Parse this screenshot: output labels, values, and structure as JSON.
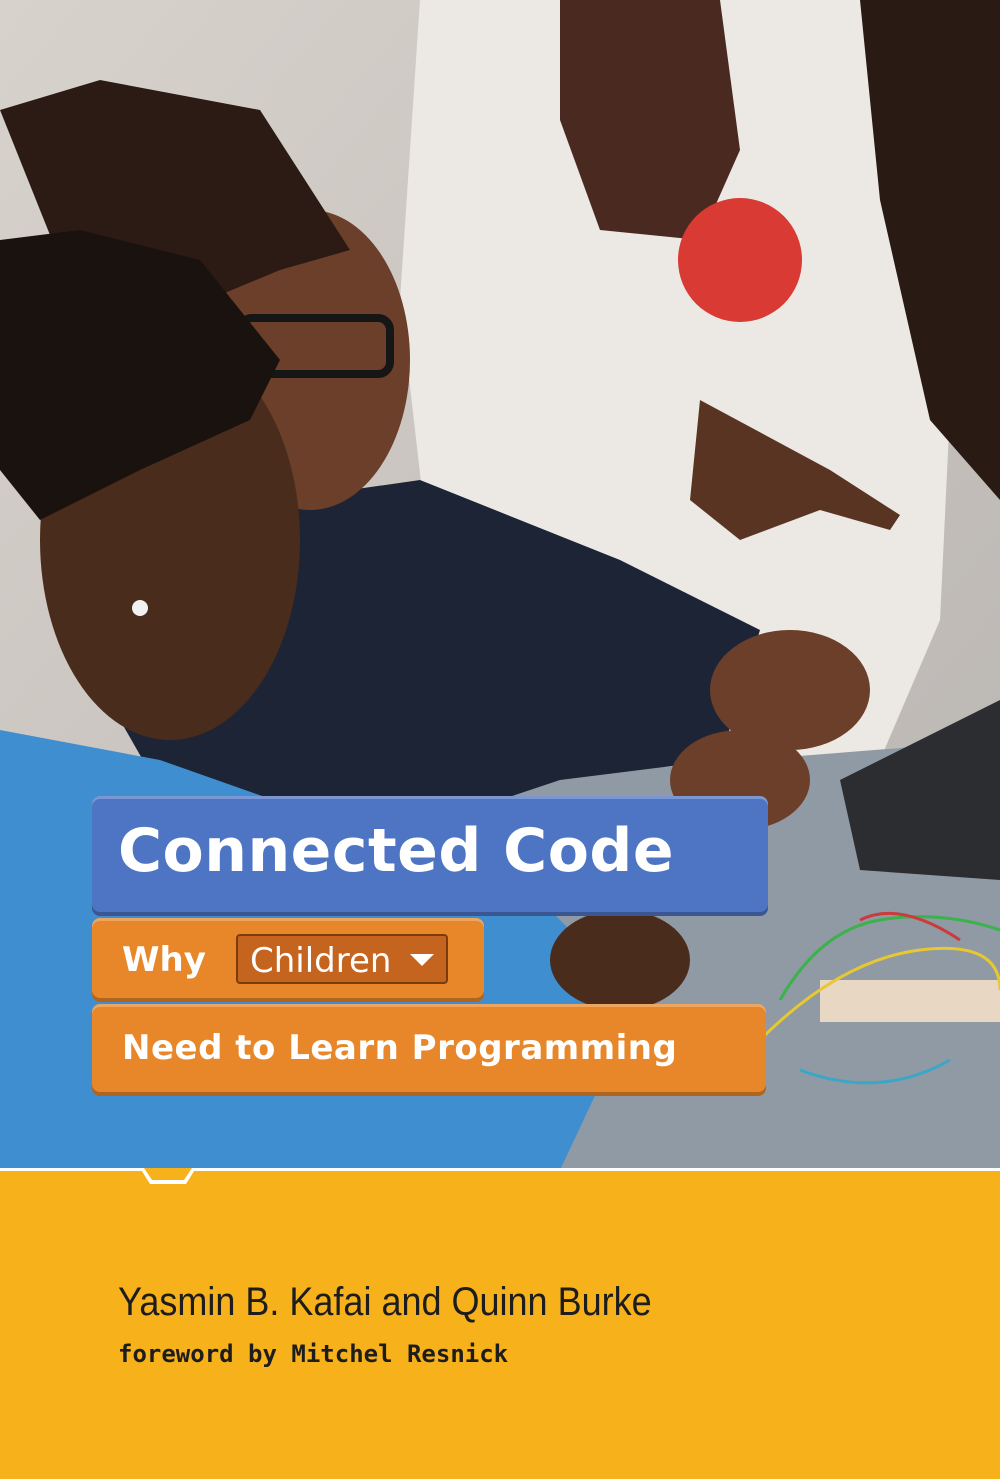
{
  "cover": {
    "title": "Connected Code",
    "subtitle_why": "Why",
    "subtitle_dropdown": "Children",
    "subtitle_rest": "Need to Learn Programming",
    "authors": "Yasmin B. Kafai and Quinn Burke",
    "foreword": "foreword by Mitchel Resnick"
  },
  "colors": {
    "title_block": "#4e74c4",
    "orange_block": "#e7872a",
    "background": "#f7b11b"
  }
}
